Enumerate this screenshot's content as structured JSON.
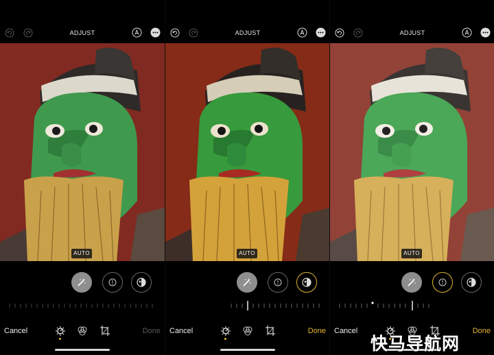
{
  "panels": [
    {
      "title": "ADJUST",
      "auto_badge": "AUTO",
      "cancel": "Cancel",
      "done": "Done",
      "done_active": false,
      "selected_tool": "auto-enhance",
      "photo_tint": "#8d3028"
    },
    {
      "title": "ADJUST",
      "auto_badge": "AUTO",
      "cancel": "Cancel",
      "done": "Done",
      "done_active": true,
      "selected_tool": "auto-enhance",
      "photo_tint": "#7a2414"
    },
    {
      "title": "ADJUST",
      "auto_badge": "AUTO",
      "cancel": "Cancel",
      "done": "Done",
      "done_active": true,
      "selected_tool": "exposure",
      "photo_tint": "#8a3a30"
    }
  ],
  "colors": {
    "accent": "#e6b830",
    "background": "#000000"
  },
  "icons": {
    "undo": "undo-icon",
    "redo": "redo-icon",
    "markup": "markup-icon",
    "more": "more-icon",
    "auto_enhance": "magic-wand-icon",
    "exposure": "exposure-icon",
    "brilliance": "brilliance-icon",
    "adjust": "adjust-icon",
    "filters": "filters-icon",
    "crop": "crop-icon"
  },
  "watermark": "快马导航网"
}
